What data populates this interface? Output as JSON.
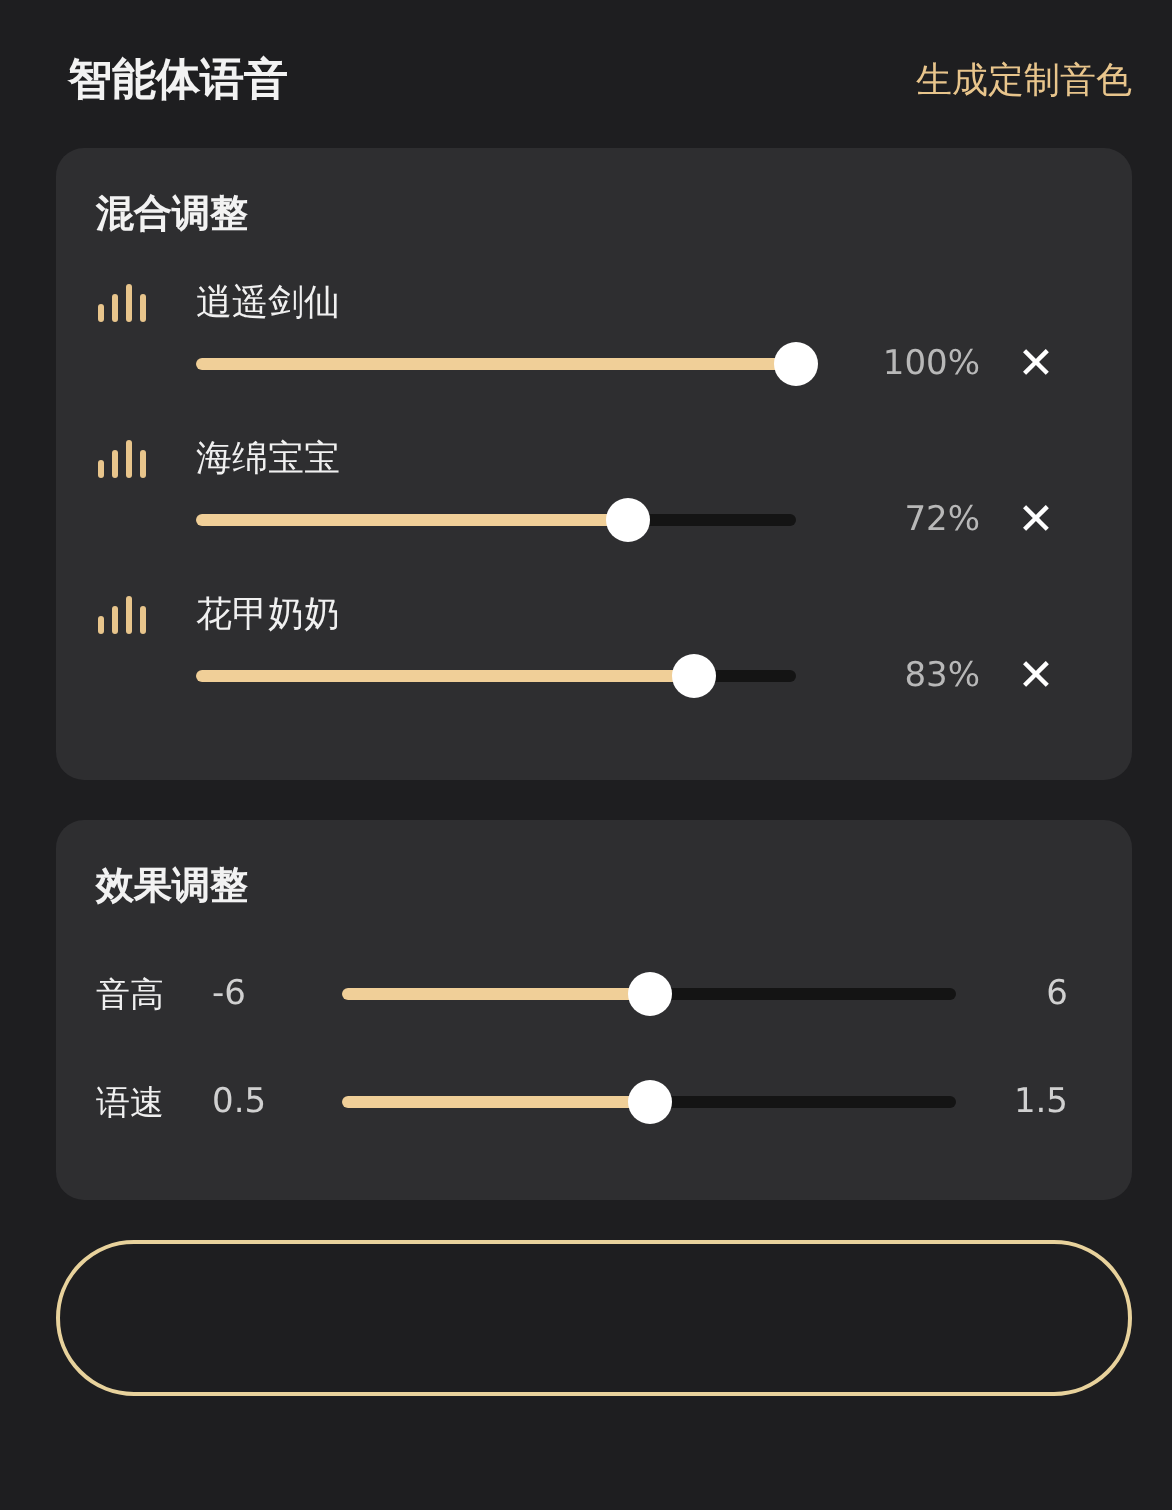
{
  "header": {
    "title": "智能体语音",
    "action": "生成定制音色"
  },
  "mix": {
    "title": "混合调整",
    "voices": [
      {
        "name": "逍遥剑仙",
        "level": 1,
        "reading": "100%",
        "remove": "✕"
      },
      {
        "name": "海绵宝宝",
        "level": 0.72,
        "reading": "72%",
        "remove": "✕"
      },
      {
        "name": "花甲奶奶",
        "level": 0.83,
        "reading": "83%",
        "remove": "✕"
      }
    ]
  },
  "effects": {
    "title": "效果调整",
    "controls": [
      {
        "label": "音高",
        "min": "-6",
        "max": "6",
        "level": 0.5
      },
      {
        "label": "语速",
        "min": "0.5",
        "max": "1.5",
        "level": 0.5
      }
    ]
  },
  "bottom_button": {
    "kind": "outline"
  }
}
